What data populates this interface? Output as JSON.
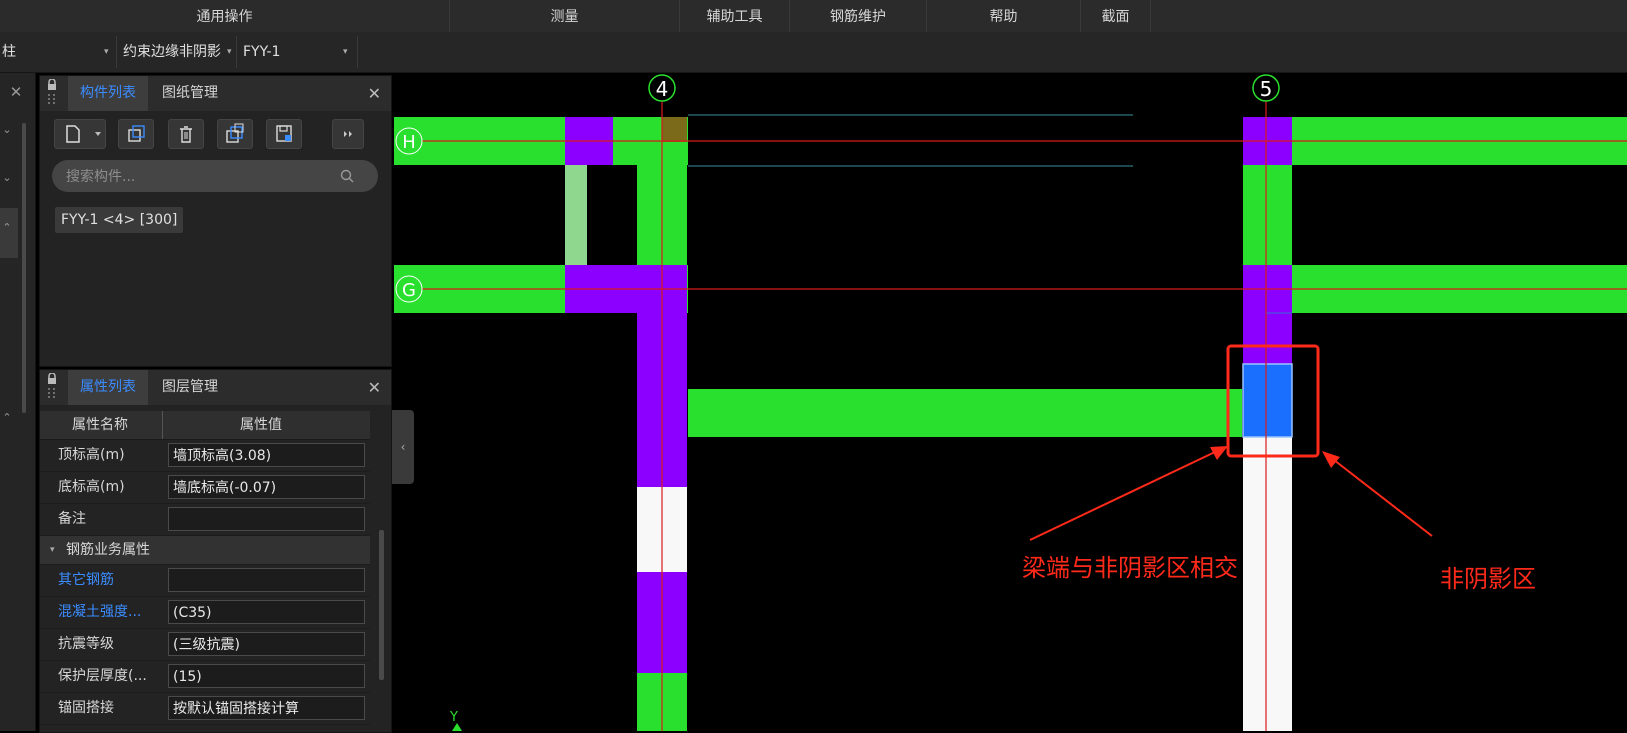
{
  "menu": {
    "items": [
      "通用操作",
      "测量",
      "辅助工具",
      "钢筋维护",
      "帮助",
      "截面"
    ]
  },
  "selectors": {
    "type": "柱",
    "category": "约束边缘非阴影",
    "component": "FYY-1"
  },
  "component_panel": {
    "tabs": [
      "构件列表",
      "图纸管理"
    ],
    "search_placeholder": "搜索构件...",
    "item": "FYY-1 <4> [300]"
  },
  "property_panel": {
    "tabs": [
      "属性列表",
      "图层管理"
    ],
    "headers": {
      "name": "属性名称",
      "value": "属性值"
    },
    "rows": [
      {
        "name": "顶标高(m)",
        "value": "墙顶标高(3.08)"
      },
      {
        "name": "底标高(m)",
        "value": "墙底标高(-0.07)"
      },
      {
        "name": "备注",
        "value": ""
      }
    ],
    "group": "钢筋业务属性",
    "group_rows": [
      {
        "name": "其它钢筋",
        "value": ""
      },
      {
        "name": "混凝土强度...",
        "value": "(C35)"
      },
      {
        "name": "抗震等级",
        "value": "(三级抗震)"
      },
      {
        "name": "保护层厚度(...",
        "value": "(15)"
      },
      {
        "name": "锚固搭接",
        "value": "按默认锚固搭接计算"
      }
    ]
  },
  "canvas": {
    "axes": {
      "col4": "4",
      "col5": "5",
      "rowH": "H",
      "rowG": "G",
      "ucs_y": "Y"
    },
    "annotations": {
      "beam_end": "梁端与非阴影区相交",
      "non_shadow": "非阴影区"
    },
    "colors": {
      "beam": "#2ae02e",
      "wall": "#8b00ff",
      "selected": "#1a6fff",
      "axis_line": "#d81b1b",
      "annotation": "#ff2a1a"
    }
  }
}
